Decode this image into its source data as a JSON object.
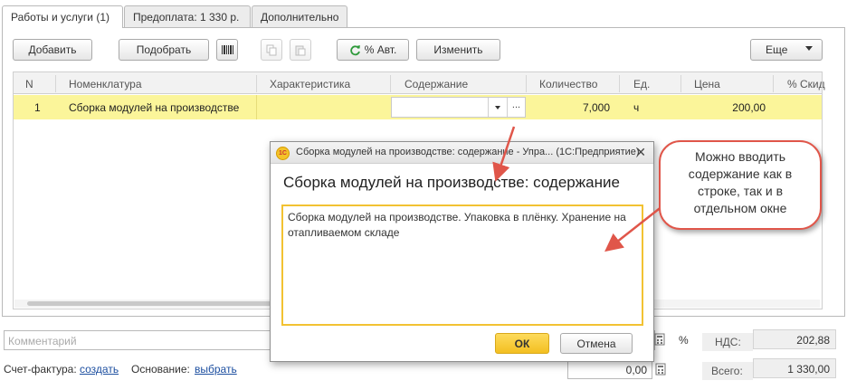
{
  "tabs": [
    {
      "label": "Работы и услуги (1)"
    },
    {
      "label": "Предоплата: 1 330 р."
    },
    {
      "label": "Дополнительно"
    }
  ],
  "toolbar": {
    "add_label": "Добавить",
    "select_label": "Подобрать",
    "auto_percent_label": "% Авт.",
    "change_label": "Изменить",
    "more_label": "Еще"
  },
  "table": {
    "columns": [
      "N",
      "Номенклатура",
      "Характеристика",
      "Содержание",
      "Количество",
      "Ед.",
      "Цена",
      "% Скид"
    ],
    "rows": [
      {
        "n": "1",
        "nomenclature": "Сборка модулей на производстве",
        "characteristic": "",
        "content": "",
        "quantity": "7,000",
        "unit": "ч",
        "price": "200,00",
        "discount": ""
      }
    ]
  },
  "dialog": {
    "title": "Сборка модулей на производстве: содержание - Упра...   (1С:Предприятие)",
    "heading": "Сборка модулей на производстве: содержание",
    "text": "Сборка модулей на производстве. Упаковка в плёнку. Хранение на отапливаемом складе",
    "ok_label": "ОК",
    "cancel_label": "Отмена"
  },
  "callout": {
    "text": "Можно вводить содержание как в строке, так и в отдельном окне"
  },
  "footer": {
    "comment_placeholder": "Комментарий",
    "percent_label": "%",
    "vat_label": "НДС:",
    "vat_value": "202,88",
    "total_label": "Всего:",
    "total_value": "1 330,00",
    "amount_value": "0,00",
    "invoice_label": "Счет-фактура:",
    "invoice_link": "создать",
    "basis_label": "Основание:",
    "basis_link": "выбрать"
  },
  "colors": {
    "row_highlight": "#fbf59a",
    "accent_border": "#f2c232",
    "ok_button": "#f7c931",
    "callout_border": "#e0564a",
    "link": "#1d4fa0"
  }
}
